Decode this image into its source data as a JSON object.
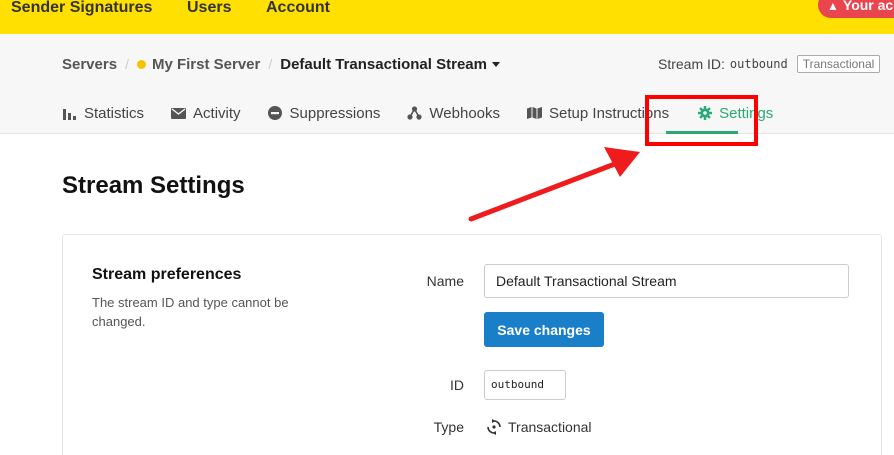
{
  "topnav": {
    "items": [
      "Sender Signatures",
      "Users",
      "Account"
    ],
    "alert_label": "Your account"
  },
  "breadcrumb": {
    "servers": "Servers",
    "server_name": "My First Server",
    "stream_name": "Default Transactional Stream"
  },
  "stream_meta": {
    "id_label": "Stream ID:",
    "id_value": "outbound",
    "type_tag": "Transactional"
  },
  "tabs": [
    {
      "label": "Statistics",
      "icon": "bar-chart-icon"
    },
    {
      "label": "Activity",
      "icon": "envelope-icon"
    },
    {
      "label": "Suppressions",
      "icon": "minus-circle-icon"
    },
    {
      "label": "Webhooks",
      "icon": "share-nodes-icon"
    },
    {
      "label": "Setup Instructions",
      "icon": "map-icon"
    },
    {
      "label": "Settings",
      "icon": "gear-icon",
      "active": true
    }
  ],
  "page": {
    "title": "Stream Settings"
  },
  "preferences": {
    "title": "Stream preferences",
    "description": "The stream ID and type cannot be changed.",
    "name_label": "Name",
    "name_value": "Default Transactional Stream",
    "save_label": "Save changes",
    "id_label": "ID",
    "id_value": "outbound",
    "type_label": "Type",
    "type_value": "Transactional"
  },
  "colors": {
    "topbar": "#ffe000",
    "accent": "#2aa876",
    "primary_button": "#1a7fc9",
    "annotation": "#ff0000"
  }
}
